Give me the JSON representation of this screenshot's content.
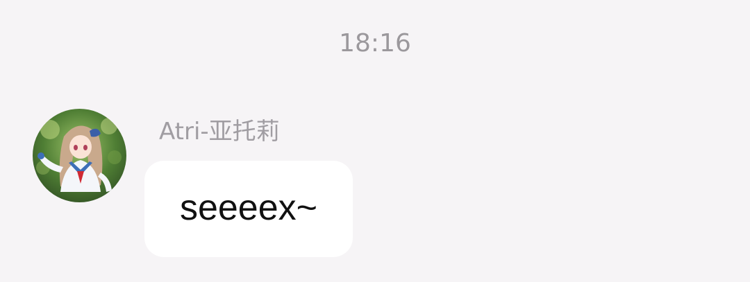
{
  "conversation": {
    "timestamp": "18:16",
    "messages": [
      {
        "sender": "Atri-亚托莉",
        "avatar_icon": "anime-girl-avatar",
        "text": "seeeex~"
      }
    ]
  },
  "colors": {
    "background": "#f6f4f6",
    "timestamp_text": "#9b989c",
    "sender_text": "#a09da2",
    "bubble_background": "#ffffff",
    "bubble_text": "#111111"
  }
}
